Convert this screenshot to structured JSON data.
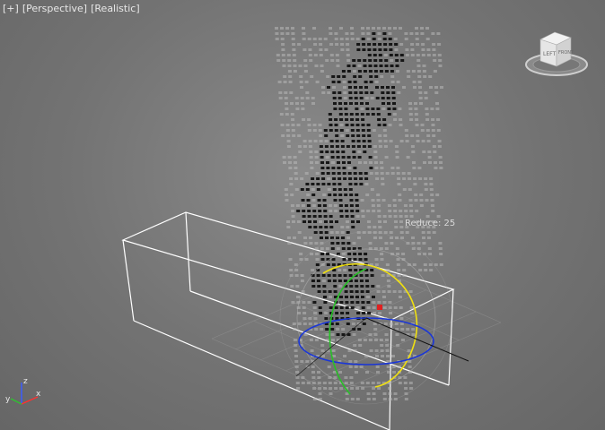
{
  "viewport": {
    "menu": {
      "plus": "[+]",
      "view": "[Perspective]",
      "shading": "[Realistic]"
    },
    "label_reduce": "Reduce: 25",
    "viewcube": {
      "face_left": "LEFT",
      "face_front": "FRONT"
    },
    "axes": {
      "x": "x",
      "y": "y",
      "z": "z"
    }
  },
  "colors": {
    "ring_x": "#e02020",
    "ring_y": "#28c028",
    "ring_z": "#1a36d8",
    "ring_screen": "#f0e010",
    "background": "#737373"
  },
  "icons": [
    "viewcube-icon",
    "axis-tripod-icon",
    "rotate-gizmo-icon"
  ]
}
